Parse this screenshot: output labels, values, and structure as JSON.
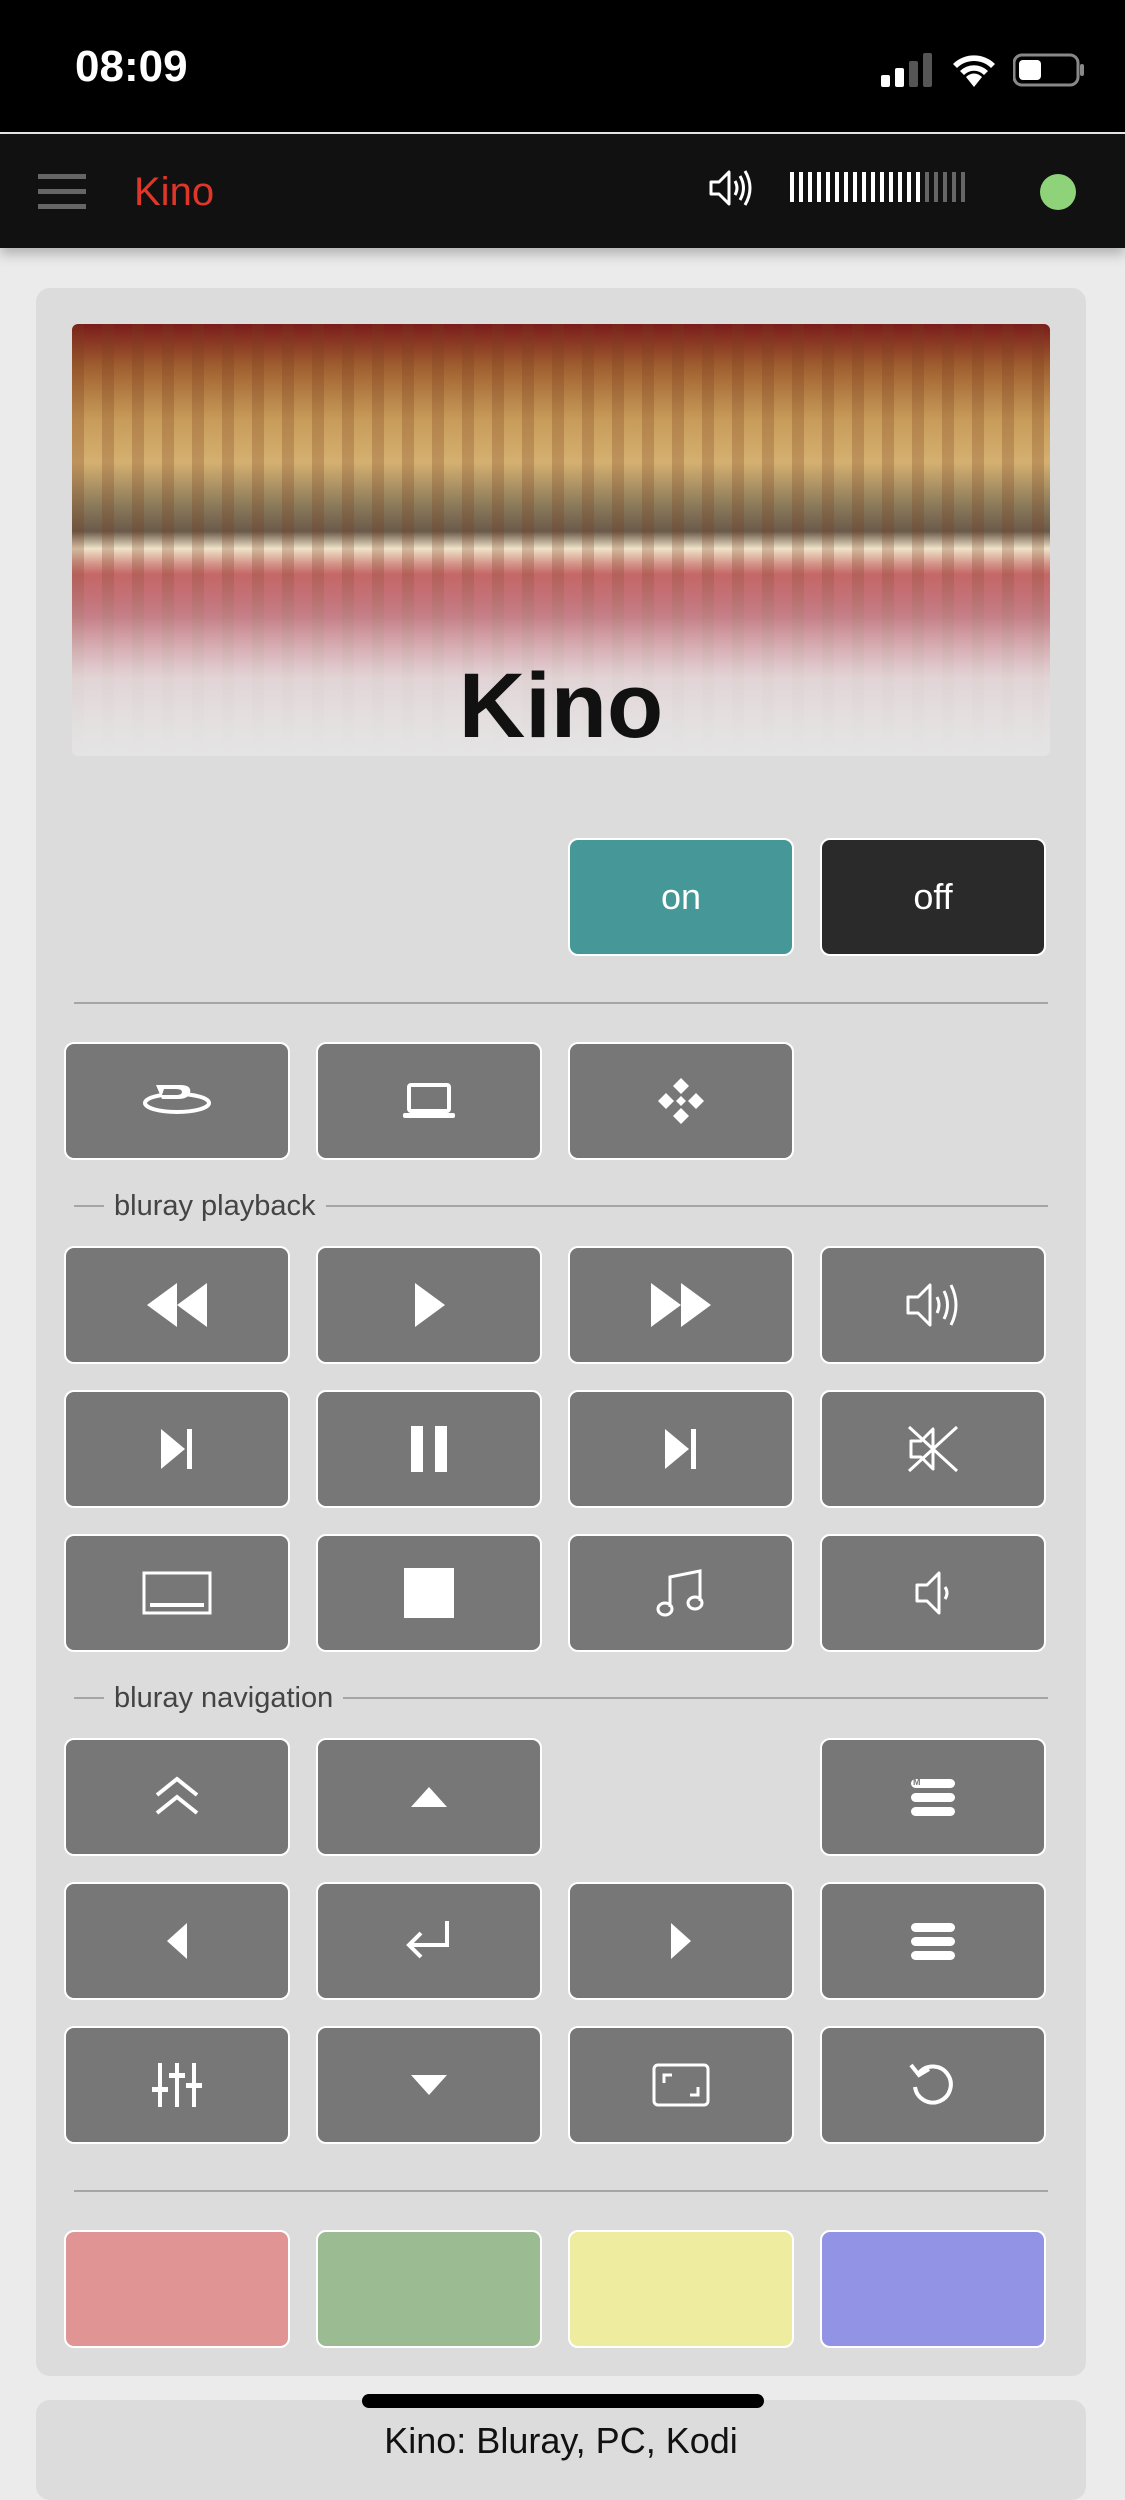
{
  "status_bar": {
    "time": "08:09"
  },
  "app_bar": {
    "title": "Kino",
    "volume_level": 0.75,
    "power_status_color": "#8ed37a"
  },
  "hero": {
    "title": "Kino"
  },
  "power": {
    "on_label": "on",
    "off_label": "off",
    "on_color": "#469898",
    "off_color": "#2a2a2a"
  },
  "sources": [
    {
      "icon": "bluray-icon"
    },
    {
      "icon": "laptop-icon"
    },
    {
      "icon": "kodi-icon"
    }
  ],
  "sections": {
    "playback": "bluray playback",
    "navigation": "bluray navigation"
  },
  "playback_buttons": [
    "rewind-icon",
    "play-icon",
    "fast-forward-icon",
    "volume-up-icon",
    "skip-previous-icon",
    "pause-icon",
    "skip-next-icon",
    "mute-icon",
    "subtitles-icon",
    "stop-icon",
    "audio-track-icon",
    "volume-down-icon"
  ],
  "navigation_buttons": [
    "top-menu-icon",
    "arrow-up-icon",
    "menu-icon",
    "arrow-left-icon",
    "enter-icon",
    "arrow-right-icon",
    "popup-menu-icon",
    "settings-icon",
    "arrow-down-icon",
    "aspect-ratio-icon",
    "return-icon"
  ],
  "color_buttons": [
    {
      "name": "red",
      "color": "#e09494"
    },
    {
      "name": "green",
      "color": "#9bbb92"
    },
    {
      "name": "yellow",
      "color": "#eeec9e"
    },
    {
      "name": "blue",
      "color": "#9393e6"
    }
  ],
  "next_card": {
    "title": "Kino: Bluray, PC, Kodi"
  }
}
